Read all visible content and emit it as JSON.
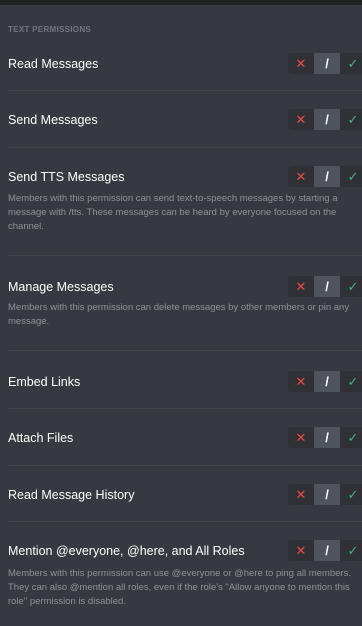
{
  "section": {
    "title": "TEXT PERMISSIONS"
  },
  "toggle_glyphs": {
    "deny": "✕",
    "neutral": "/",
    "allow": "✓"
  },
  "colors": {
    "deny": "#f04747",
    "neutral": "#4f545c",
    "allow": "#43b581",
    "background": "#36393f"
  },
  "permissions": [
    {
      "title": "Read Messages",
      "description": ""
    },
    {
      "title": "Send Messages",
      "description": ""
    },
    {
      "title": "Send TTS Messages",
      "description": "Members with this permission can send text-to-speech messages by starting a message with /tts. These messages can be heard by everyone focused on the channel."
    },
    {
      "title": "Manage Messages",
      "description": "Members with this permission can delete messages by other members or pin any message."
    },
    {
      "title": "Embed Links",
      "description": ""
    },
    {
      "title": "Attach Files",
      "description": ""
    },
    {
      "title": "Read Message History",
      "description": ""
    },
    {
      "title": "Mention @everyone, @here, and All Roles",
      "description": "Members with this permission can use @everyone or @here to ping all members. They can also @mention all roles, even if the role's \"Allow anyone to mention this role\" permission is disabled."
    }
  ]
}
